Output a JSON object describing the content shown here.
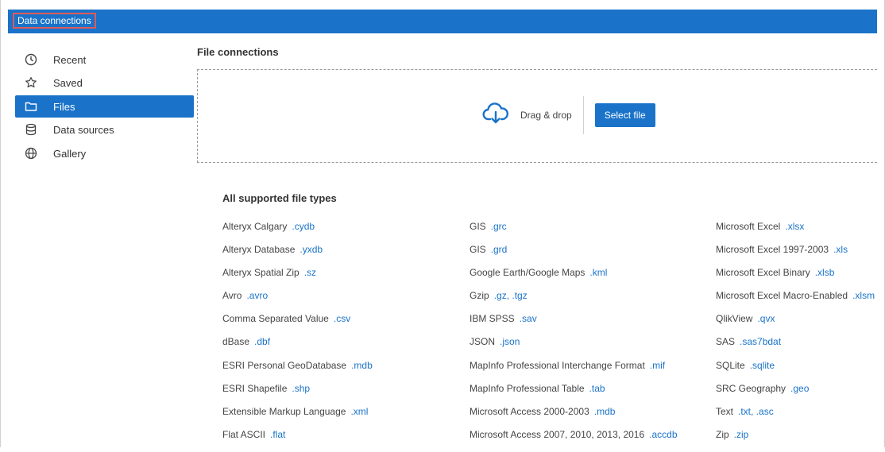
{
  "window": {
    "title": "Data connections"
  },
  "sidebar": {
    "items": [
      {
        "label": "Recent",
        "icon": "clock-icon"
      },
      {
        "label": "Saved",
        "icon": "star-icon"
      },
      {
        "label": "Files",
        "icon": "folder-icon",
        "active": true
      },
      {
        "label": "Data sources",
        "icon": "database-icon"
      },
      {
        "label": "Gallery",
        "icon": "globe-icon"
      }
    ]
  },
  "main": {
    "section_title": "File connections",
    "dropzone": {
      "label": "Drag & drop",
      "icon": "cloud-download-icon",
      "button_label": "Select file"
    },
    "file_types_title": "All supported file types",
    "columns": [
      [
        {
          "name": "Alteryx Calgary",
          "ext": ".cydb"
        },
        {
          "name": "Alteryx Database",
          "ext": ".yxdb"
        },
        {
          "name": "Alteryx Spatial Zip",
          "ext": ".sz"
        },
        {
          "name": "Avro",
          "ext": ".avro"
        },
        {
          "name": "Comma Separated Value",
          "ext": ".csv"
        },
        {
          "name": "dBase",
          "ext": ".dbf"
        },
        {
          "name": "ESRI Personal GeoDatabase",
          "ext": ".mdb"
        },
        {
          "name": "ESRI Shapefile",
          "ext": ".shp"
        },
        {
          "name": "Extensible Markup Language",
          "ext": ".xml"
        },
        {
          "name": "Flat ASCII",
          "ext": ".flat"
        }
      ],
      [
        {
          "name": "GIS",
          "ext": ".grc"
        },
        {
          "name": "GIS",
          "ext": ".grd"
        },
        {
          "name": "Google Earth/Google Maps",
          "ext": ".kml"
        },
        {
          "name": "Gzip",
          "ext": ".gz, .tgz"
        },
        {
          "name": "IBM SPSS",
          "ext": ".sav"
        },
        {
          "name": "JSON",
          "ext": ".json"
        },
        {
          "name": "MapInfo Professional Interchange Format",
          "ext": ".mif"
        },
        {
          "name": "MapInfo Professional Table",
          "ext": ".tab"
        },
        {
          "name": "Microsoft Access 2000-2003",
          "ext": ".mdb"
        },
        {
          "name": "Microsoft Access 2007, 2010, 2013, 2016",
          "ext": ".accdb"
        }
      ],
      [
        {
          "name": "Microsoft Excel",
          "ext": ".xlsx"
        },
        {
          "name": "Microsoft Excel 1997-2003",
          "ext": ".xls"
        },
        {
          "name": "Microsoft Excel Binary",
          "ext": ".xlsb"
        },
        {
          "name": "Microsoft Excel Macro-Enabled",
          "ext": ".xlsm"
        },
        {
          "name": "QlikView",
          "ext": ".qvx"
        },
        {
          "name": "SAS",
          "ext": ".sas7bdat"
        },
        {
          "name": "SQLite",
          "ext": ".sqlite"
        },
        {
          "name": "SRC Geography",
          "ext": ".geo"
        },
        {
          "name": "Text",
          "ext": ".txt, .asc"
        },
        {
          "name": "Zip",
          "ext": ".zip"
        }
      ]
    ]
  },
  "colors": {
    "accent": "#1a73c9",
    "highlight_border": "#e05a5a"
  }
}
